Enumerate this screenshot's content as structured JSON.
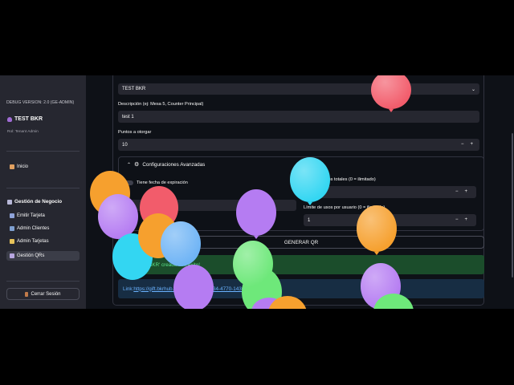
{
  "sidebar": {
    "debug_version": "DEBUG VERSION: 2.0 (GE-ADMIN)",
    "user_name": "TEST BKR",
    "role": "Rol: Tenant Admin",
    "home_label": "Inicio",
    "section_title": "Gestión de Negocio",
    "items": [
      {
        "label": "Emitir Tarjeta"
      },
      {
        "label": "Admin Clientes"
      },
      {
        "label": "Admin Tarjetas"
      },
      {
        "label": "Gestión QRs"
      }
    ],
    "logout_label": "Cerrar Sesión"
  },
  "form": {
    "business_value": "TEST BKR",
    "description_label": "Descripción (ej: Mesa 5, Counter Principal)",
    "description_value": "test 1",
    "points_label": "Puntos a otorgar",
    "points_value": "10",
    "advanced_title": "Configuraciones Avanzadas",
    "expiration_label": "Tiene fecha de expiración",
    "total_uses_label": "Límite de usos totales (0 = ilimitado)",
    "total_uses_value": "0",
    "per_user_label": "Límite de usos por usuario (0 = ilimitado)",
    "per_user_value": "1",
    "generate_label": "GENERAR QR",
    "success_text": "QR 'TEST BKR' creado con éxito!",
    "link_prefix": "Link: ",
    "link_url": "https://gift.bkrhub.com/sub/1097-1534-4770-1436"
  },
  "colors": {
    "accent": "#ff4b4b",
    "success_bg": "#1b4d2b",
    "success_text": "#5ce68c",
    "info_bg": "#172d43",
    "link": "#6ab2ff"
  }
}
